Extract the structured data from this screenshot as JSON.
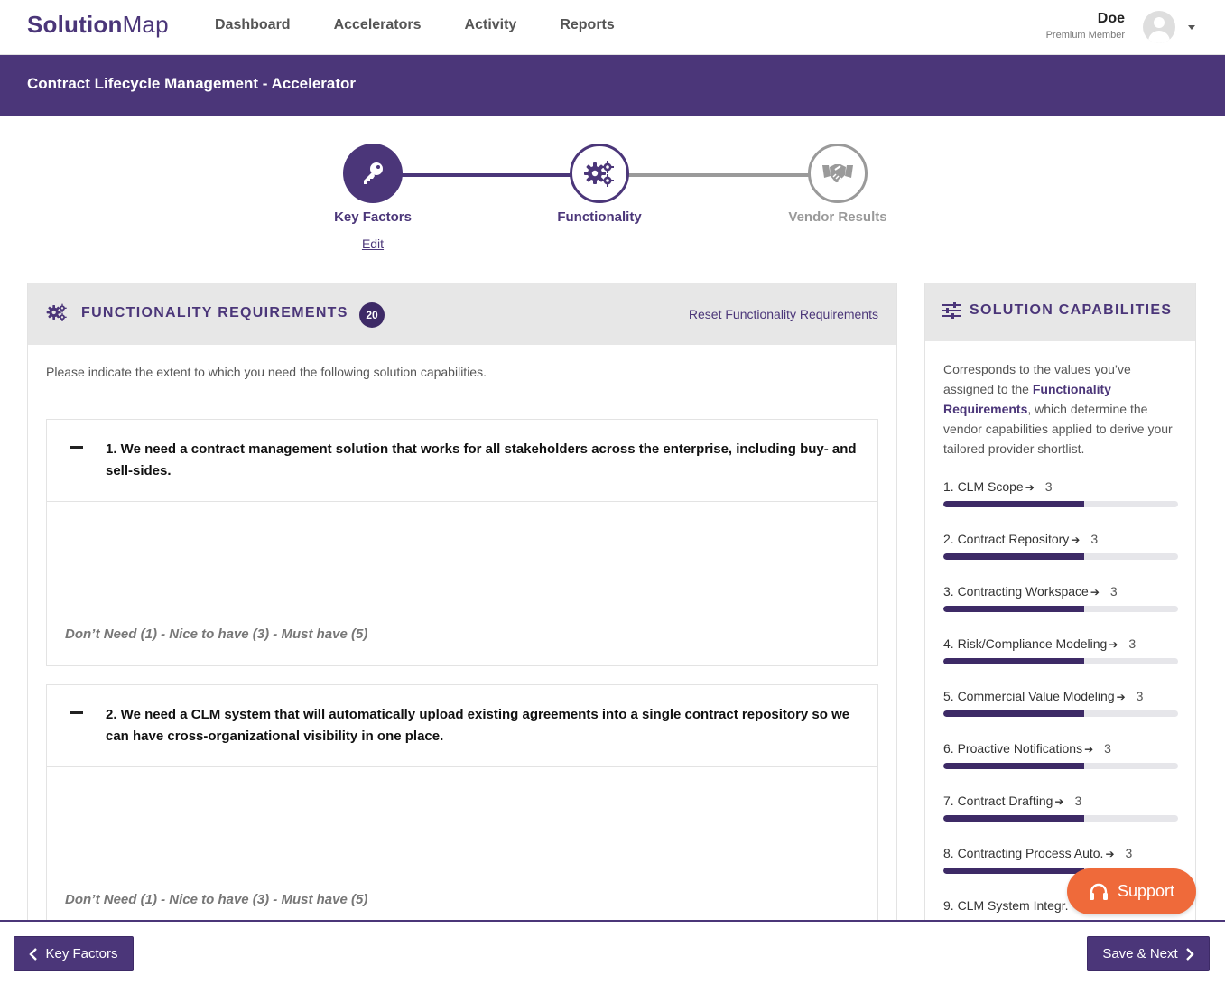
{
  "brand": {
    "bold": "Solution",
    "light": "Map",
    "color": "#4b3679"
  },
  "nav": {
    "items": [
      "Dashboard",
      "Accelerators",
      "Activity",
      "Reports"
    ]
  },
  "user": {
    "name": "Doe",
    "role": "Premium Member"
  },
  "page": {
    "title": "Contract Lifecycle Management - Accelerator"
  },
  "stepper": {
    "steps": [
      {
        "label": "Key Factors",
        "icon": "key-icon",
        "state": "complete"
      },
      {
        "label": "Functionality",
        "icon": "gears-icon",
        "state": "active"
      },
      {
        "label": "Vendor Results",
        "icon": "handshake-icon",
        "state": "pending"
      }
    ],
    "edit_label": "Edit"
  },
  "requirements": {
    "title": "FUNCTIONALITY REQUIREMENTS",
    "count": "20",
    "reset_label": "Reset Functionality Requirements",
    "instructions": "Please indicate the extent to which you need the following solution capabilities.",
    "items": [
      {
        "text": "1. We need a contract management solution that works for all stakeholders across the enterprise, including buy- and sell-sides.",
        "scale": "Don’t Need (1) - Nice to have (3) - Must have (5)"
      },
      {
        "text": "2. We need a CLM system that will automatically upload existing agreements into a single contract repository so we can have cross-organizational visibility in one place.",
        "scale": "Don’t Need (1) - Nice to have (3) - Must have (5)"
      }
    ]
  },
  "capabilities": {
    "title": "SOLUTION CAPABILITIES",
    "desc_pre": "Corresponds to the values you’ve assigned to the ",
    "desc_bold": "Functionality Requirements",
    "desc_post": ", which determine the vendor capabilities applied to derive your tailored provider shortlist.",
    "max_value": 5,
    "items": [
      {
        "label": "1. CLM Scope",
        "value": "3"
      },
      {
        "label": "2. Contract Repository",
        "value": "3"
      },
      {
        "label": "3. Contracting Workspace",
        "value": "3"
      },
      {
        "label": "4. Risk/Compliance Modeling",
        "value": "3"
      },
      {
        "label": "5. Commercial Value Modeling",
        "value": "3"
      },
      {
        "label": "6. Proactive Notifications",
        "value": "3"
      },
      {
        "label": "7. Contract Drafting",
        "value": "3"
      },
      {
        "label": "8. Contracting Process Auto.",
        "value": "3"
      },
      {
        "label": "9. CLM System Integr.",
        "value": ""
      }
    ]
  },
  "support": {
    "label": "Support",
    "color": "#ef6a3a"
  },
  "footer": {
    "back_label": "Key Factors",
    "next_label": "Save & Next"
  }
}
